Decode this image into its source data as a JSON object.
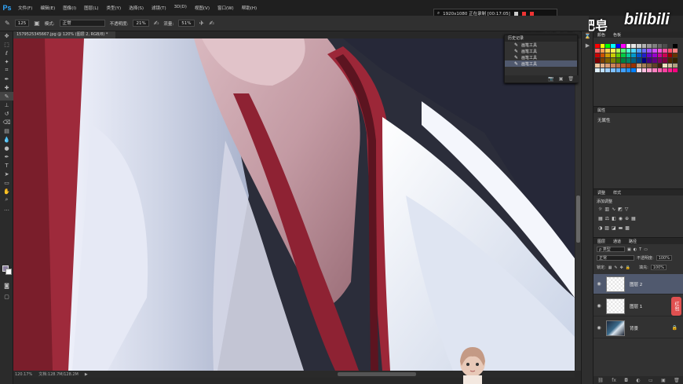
{
  "app": {
    "logo": "Ps"
  },
  "menu": [
    "文件(F)",
    "编辑(E)",
    "图像(I)",
    "图层(L)",
    "类型(Y)",
    "选择(S)",
    "滤镜(T)",
    "3D(D)",
    "视图(V)",
    "窗口(W)",
    "帮助(H)"
  ],
  "recorder": {
    "text": "1920x1080  正在录制 [00:17:05]"
  },
  "watermark": {
    "text": "这里有块大肥皂",
    "logo": "bilibili"
  },
  "options": {
    "brush_size": "125",
    "mode_label": "模式:",
    "mode_value": "正常",
    "opacity_label": "不透明度:",
    "opacity_value": "21%",
    "flow_label": "流量:",
    "flow_value": "51%"
  },
  "document": {
    "tab_title": "1579525345667.jpg @ 120% (图层 2, RGB/8) *"
  },
  "status": {
    "zoom": "120.17%",
    "doc_info": "文档:128.7M/128.2M"
  },
  "swatches": {
    "tabs": [
      "颜色",
      "色板"
    ],
    "colors": [
      "#ff0000",
      "#ffff00",
      "#00ff00",
      "#00ffff",
      "#0000ff",
      "#ff00ff",
      "#ffffff",
      "#e6e6e6",
      "#cccccc",
      "#b3b3b3",
      "#999999",
      "#808080",
      "#666666",
      "#4d4d4d",
      "#333333",
      "#000000",
      "#ff6a6a",
      "#ff9e4f",
      "#ffd24f",
      "#ffee4f",
      "#b6ff4f",
      "#4fff7a",
      "#4fffd2",
      "#4fd8ff",
      "#4f9eff",
      "#6a6aff",
      "#a04fff",
      "#d24fff",
      "#ff4fd8",
      "#ff4f9e",
      "#ff4f6a",
      "#ff8080",
      "#cc0000",
      "#cc5200",
      "#cc9900",
      "#cccc00",
      "#66cc00",
      "#00cc44",
      "#00cc99",
      "#0099cc",
      "#0052cc",
      "#1f1fcc",
      "#6600cc",
      "#9900cc",
      "#cc0099",
      "#cc0052",
      "#990000",
      "#663300",
      "#800000",
      "#804000",
      "#806000",
      "#808000",
      "#408000",
      "#008040",
      "#008060",
      "#006080",
      "#004080",
      "#000080",
      "#400080",
      "#600080",
      "#800060",
      "#800040",
      "#4d2600",
      "#332200",
      "#f2c9a0",
      "#e6b38a",
      "#d99c73",
      "#cc855c",
      "#bf6e45",
      "#b3572e",
      "#a64017",
      "#993000",
      "#c8a078",
      "#a68058",
      "#846040",
      "#624028",
      "#402010",
      "#f0e0c0",
      "#d0c0a0",
      "#b0a080",
      "#e0f0ff",
      "#c0e0ff",
      "#a0d0ff",
      "#80c0ff",
      "#60b0ff",
      "#40a0ff",
      "#2090ff",
      "#0080ff",
      "#ffe0f0",
      "#ffc0e0",
      "#ffa0d0",
      "#ff80c0",
      "#ff60b0",
      "#ff40a0",
      "#ff2090",
      "#ff0080"
    ]
  },
  "properties": {
    "tabs": [
      "属性"
    ],
    "value": "无属性"
  },
  "adjustments": {
    "tabs": [
      "调整",
      "样式"
    ],
    "label": "添加调整"
  },
  "layers": {
    "tabs": [
      "图层",
      "通道",
      "路径"
    ],
    "filter_label": "ρ 类型",
    "blend": "正常",
    "opacity_label": "不透明度:",
    "opacity_value": "100%",
    "lock_label": "锁定:",
    "fill_label": "填充:",
    "fill_value": "100%",
    "items": [
      {
        "name": "图层 2",
        "thumb": "checker",
        "active": true
      },
      {
        "name": "图层 1",
        "thumb": "checker",
        "active": false
      },
      {
        "name": "背景",
        "thumb": "photo",
        "active": false
      }
    ]
  },
  "history": {
    "title": "历史记录",
    "items": [
      "画笔工具",
      "画笔工具",
      "画笔工具",
      "画笔工具"
    ]
  },
  "side_tab": {
    "text": "红包"
  }
}
